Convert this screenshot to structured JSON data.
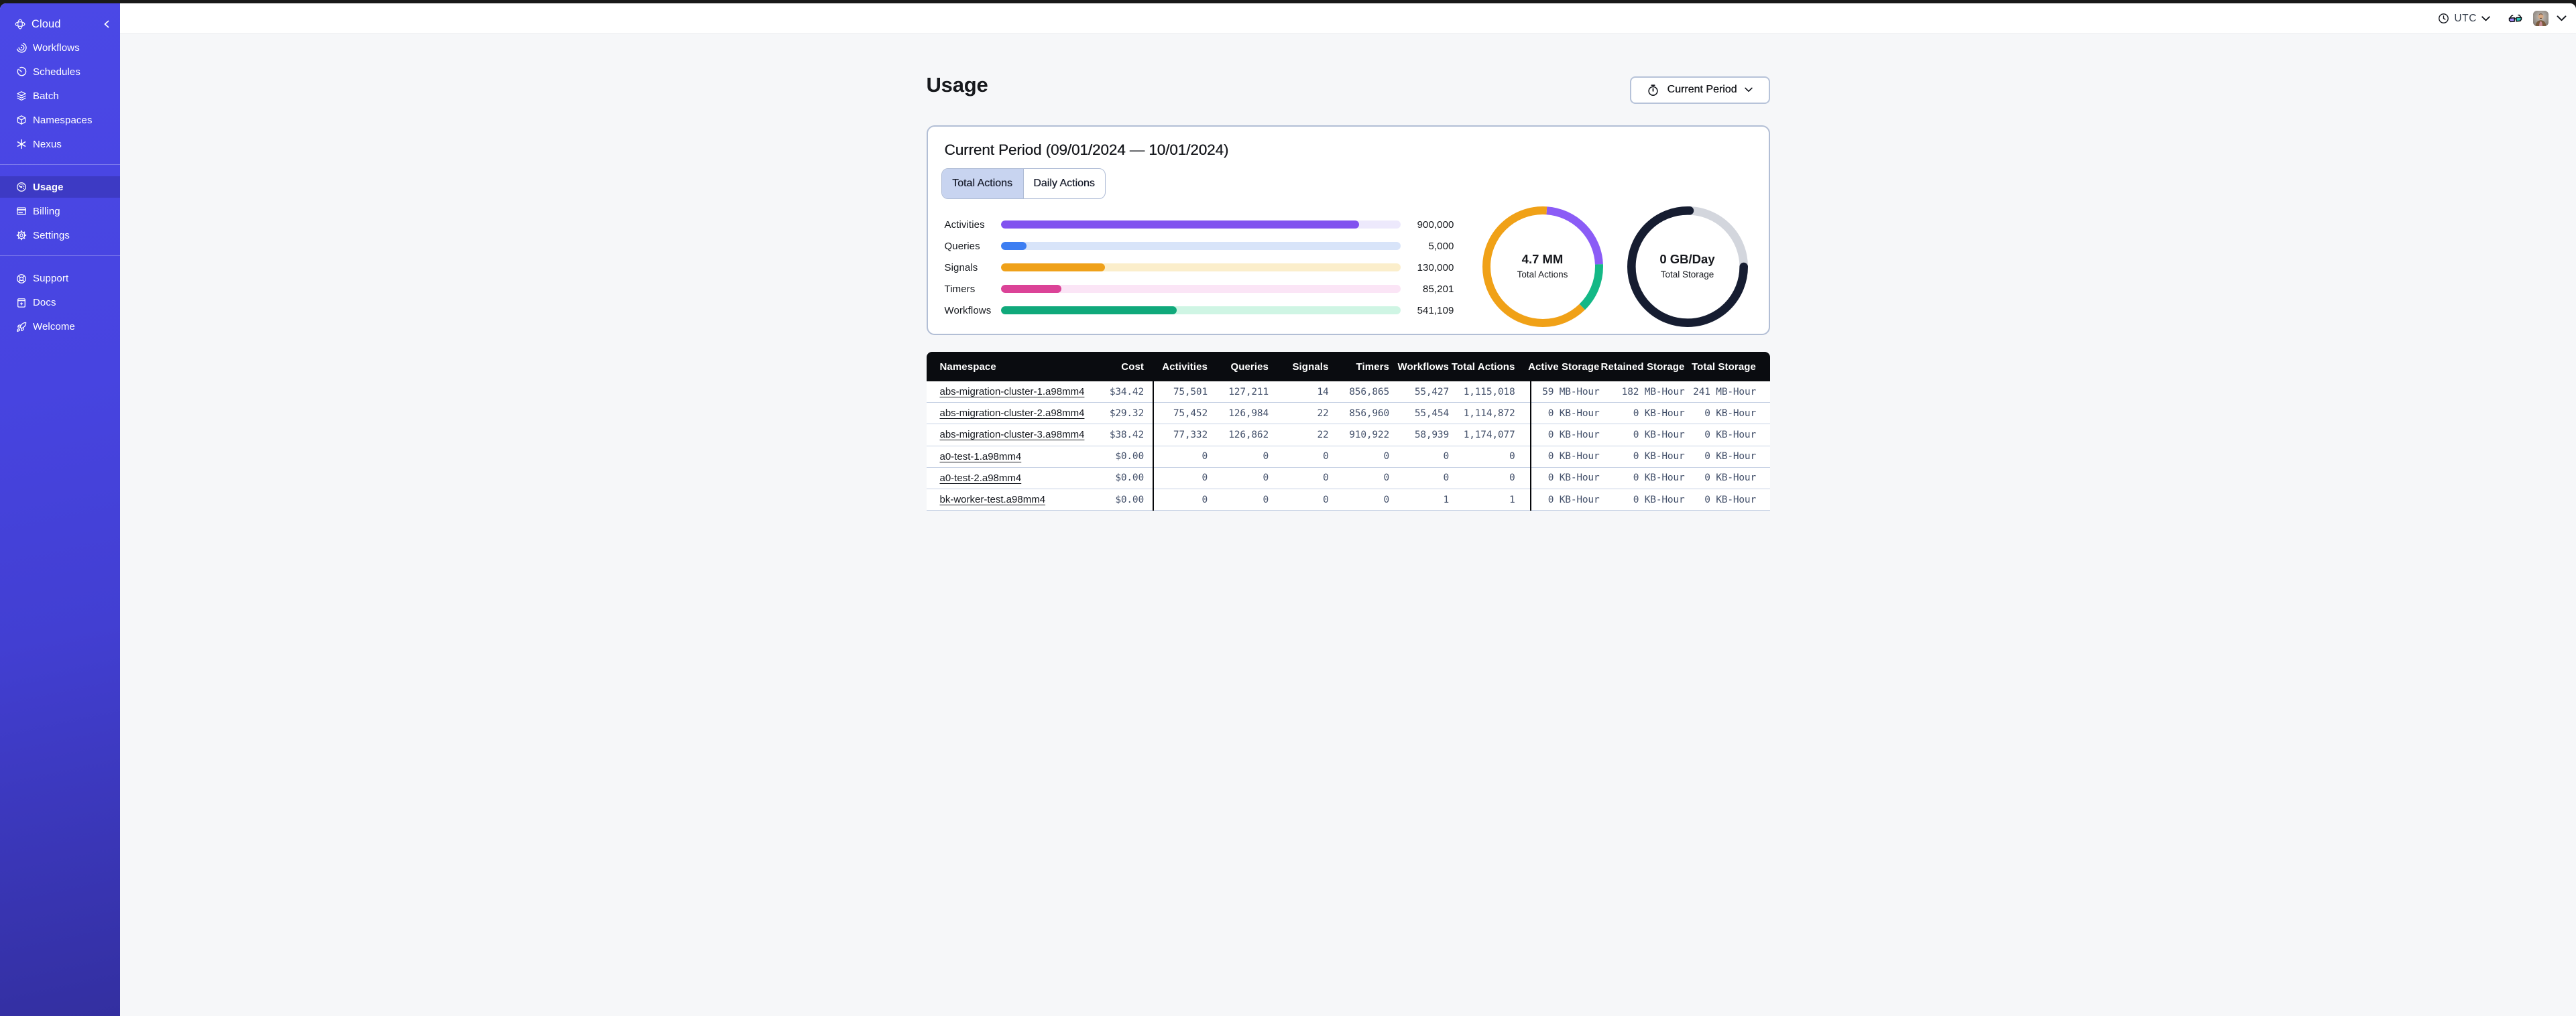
{
  "sidebar": {
    "brand": "Cloud",
    "sections": [
      {
        "items": [
          {
            "label": "Workflows",
            "icon": "workflows-icon"
          },
          {
            "label": "Schedules",
            "icon": "schedules-icon"
          },
          {
            "label": "Batch",
            "icon": "batch-icon"
          },
          {
            "label": "Namespaces",
            "icon": "namespaces-icon"
          },
          {
            "label": "Nexus",
            "icon": "nexus-icon"
          }
        ]
      },
      {
        "items": [
          {
            "label": "Usage",
            "icon": "usage-icon",
            "selected": true
          },
          {
            "label": "Billing",
            "icon": "billing-icon"
          },
          {
            "label": "Settings",
            "icon": "settings-icon"
          }
        ]
      },
      {
        "items": [
          {
            "label": "Support",
            "icon": "support-icon"
          },
          {
            "label": "Docs",
            "icon": "docs-icon"
          },
          {
            "label": "Welcome",
            "icon": "welcome-icon"
          }
        ]
      }
    ]
  },
  "topbar": {
    "timezone": "UTC"
  },
  "page": {
    "title": "Usage",
    "period_selector_label": "Current Period"
  },
  "usage_panel": {
    "heading": "Current Period (09/01/2024 — 10/01/2024)",
    "tabs": [
      {
        "label": "Total Actions",
        "selected": true
      },
      {
        "label": "Daily Actions",
        "selected": false
      }
    ]
  },
  "chart_data": [
    {
      "type": "bar",
      "title": "Total Actions by type (current period)",
      "categories": [
        "Activities",
        "Queries",
        "Signals",
        "Timers",
        "Workflows"
      ],
      "values": [
        900000,
        5000,
        130000,
        85201,
        541109
      ],
      "value_labels": [
        "900,000",
        "5,000",
        "130,000",
        "85,201",
        "541,109"
      ],
      "fill_fractions": [
        0.896,
        0.065,
        0.261,
        0.152,
        0.441
      ],
      "bar_colors": [
        "#8152EF",
        "#3D7EF2",
        "#EFA11A",
        "#DB4397",
        "#10A97B"
      ],
      "track_colors": [
        "#EDE9FC",
        "#D8E4F9",
        "#FBEECB",
        "#FBE5F6",
        "#CFF5E4"
      ]
    },
    {
      "type": "pie",
      "center_value": "4.7 MM",
      "center_label": "Total Actions",
      "ring_width": 12,
      "segments": [
        {
          "name": "activities",
          "color": "#8B5CF6",
          "start_deg": 4,
          "end_deg": 87.5
        },
        {
          "name": "workflows",
          "color": "#14B886",
          "start_deg": 87.5,
          "end_deg": 135.5
        },
        {
          "name": "other",
          "color": "#F0A117",
          "start_deg": 135.5,
          "end_deg": 364
        }
      ]
    },
    {
      "type": "pie",
      "center_value": "0 GB/Day",
      "center_label": "Total Storage",
      "ring_width": 12.6,
      "track_color": "#D3D6DD",
      "segments": [
        {
          "name": "used",
          "color": "#161D31",
          "start_deg": 90,
          "end_deg": 362,
          "round_cap": true
        }
      ]
    }
  ],
  "table": {
    "columns": [
      "Namespace",
      "Cost",
      "Activities",
      "Queries",
      "Signals",
      "Timers",
      "Workflows",
      "Total Actions",
      "Active Storage",
      "Retained Storage",
      "Total Storage"
    ],
    "rows": [
      {
        "namespace": "abs-migration-cluster-1.a98mm4",
        "cost": "$34.42",
        "activities": "75,501",
        "queries": "127,211",
        "signals": "14",
        "timers": "856,865",
        "workflows": "55,427",
        "total_actions": "1,115,018",
        "active_storage": "59 MB-Hour",
        "retained_storage": "182 MB-Hour",
        "total_storage": "241 MB-Hour"
      },
      {
        "namespace": "abs-migration-cluster-2.a98mm4",
        "cost": "$29.32",
        "activities": "75,452",
        "queries": "126,984",
        "signals": "22",
        "timers": "856,960",
        "workflows": "55,454",
        "total_actions": "1,114,872",
        "active_storage": "0 KB-Hour",
        "retained_storage": "0 KB-Hour",
        "total_storage": "0 KB-Hour"
      },
      {
        "namespace": "abs-migration-cluster-3.a98mm4",
        "cost": "$38.42",
        "activities": "77,332",
        "queries": "126,862",
        "signals": "22",
        "timers": "910,922",
        "workflows": "58,939",
        "total_actions": "1,174,077",
        "active_storage": "0 KB-Hour",
        "retained_storage": "0 KB-Hour",
        "total_storage": "0 KB-Hour"
      },
      {
        "namespace": "a0-test-1.a98mm4",
        "cost": "$0.00",
        "activities": "0",
        "queries": "0",
        "signals": "0",
        "timers": "0",
        "workflows": "0",
        "total_actions": "0",
        "active_storage": "0 KB-Hour",
        "retained_storage": "0 KB-Hour",
        "total_storage": "0 KB-Hour"
      },
      {
        "namespace": "a0-test-2.a98mm4",
        "cost": "$0.00",
        "activities": "0",
        "queries": "0",
        "signals": "0",
        "timers": "0",
        "workflows": "0",
        "total_actions": "0",
        "active_storage": "0 KB-Hour",
        "retained_storage": "0 KB-Hour",
        "total_storage": "0 KB-Hour"
      },
      {
        "namespace": "bk-worker-test.a98mm4",
        "cost": "$0.00",
        "activities": "0",
        "queries": "0",
        "signals": "0",
        "timers": "0",
        "workflows": "1",
        "total_actions": "1",
        "active_storage": "0 KB-Hour",
        "retained_storage": "0 KB-Hour",
        "total_storage": "0 KB-Hour"
      }
    ]
  }
}
